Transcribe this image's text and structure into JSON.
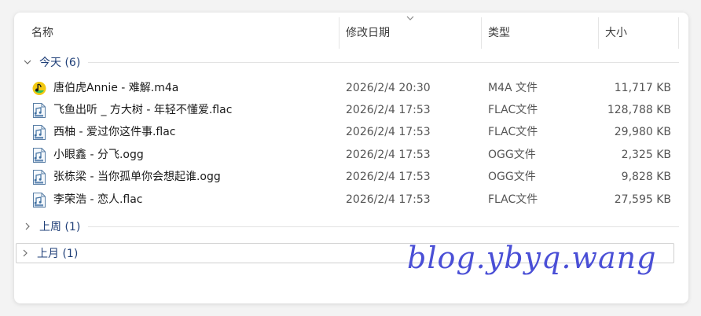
{
  "columns": {
    "name": "名称",
    "date": "修改日期",
    "type": "类型",
    "size": "大小"
  },
  "groups": [
    {
      "label": "今天 (6)",
      "expanded": true
    },
    {
      "label": "上周 (1)",
      "expanded": false
    },
    {
      "label": "上月 (1)",
      "expanded": false
    }
  ],
  "files": [
    {
      "name": "唐伯虎Annie - 难解.m4a",
      "date": "2026/2/4 20:30",
      "type": "M4A 文件",
      "size": "11,717 KB",
      "icon": "qq-music-icon"
    },
    {
      "name": "飞鱼出听 _ 方大树 - 年轻不懂爱.flac",
      "date": "2026/2/4 17:53",
      "type": "FLAC文件",
      "size": "128,788 KB",
      "icon": "flac-file-icon"
    },
    {
      "name": "西柚 - 爱过你这件事.flac",
      "date": "2026/2/4 17:53",
      "type": "FLAC文件",
      "size": "29,980 KB",
      "icon": "flac-file-icon"
    },
    {
      "name": "小眼鑫 - 分飞.ogg",
      "date": "2026/2/4 17:53",
      "type": "OGG文件",
      "size": "2,325 KB",
      "icon": "ogg-file-icon"
    },
    {
      "name": "张栋梁 - 当你孤单你会想起谁.ogg",
      "date": "2026/2/4 17:53",
      "type": "OGG文件",
      "size": "9,828 KB",
      "icon": "ogg-file-icon"
    },
    {
      "name": "李荣浩 - 恋人.flac",
      "date": "2026/2/4 17:53",
      "type": "FLAC文件",
      "size": "27,595 KB",
      "icon": "flac-file-icon"
    }
  ],
  "watermark": "blog.ybyq.wang",
  "colors": {
    "group_text": "#1f3f78",
    "watermark": "#4a4fd6",
    "qq_music_green": "#2ec15e",
    "qq_music_yellow": "#f2c811"
  }
}
